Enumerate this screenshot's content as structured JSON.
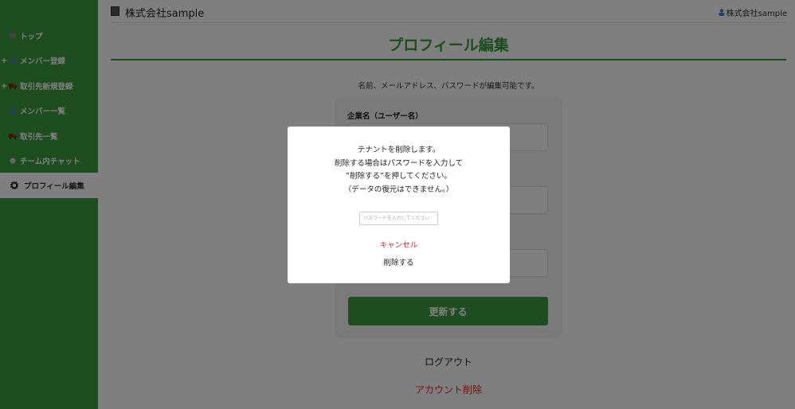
{
  "sidebar": {
    "items": [
      {
        "label": "トップ",
        "icon": "home-icon",
        "plus": ""
      },
      {
        "label": "メンバー登録",
        "icon": "user-icon",
        "plus": "+"
      },
      {
        "label": "取引先新規登録",
        "icon": "truck-icon",
        "plus": "+"
      },
      {
        "label": "メンバー一覧",
        "icon": "users-icon",
        "plus": ""
      },
      {
        "label": "取引先一覧",
        "icon": "truck-icon",
        "plus": ""
      },
      {
        "label": "チーム内チャット",
        "icon": "chat-icon",
        "plus": ""
      },
      {
        "label": "プロフィール編集",
        "icon": "gear-icon",
        "plus": "",
        "active": true
      }
    ]
  },
  "header": {
    "company": "株式会社sample",
    "user": "株式会社sample"
  },
  "main": {
    "title": "プロフィール編集",
    "subtitle": "名前、メールアドレス、パスワードが編集可能です。",
    "field_label": "企業名（ユーザー名）",
    "update_button": "更新する",
    "logout": "ログアウト",
    "delete_account": "アカウント削除"
  },
  "modal": {
    "line1": "テナントを削除します。",
    "line2": "削除する場合はパスワードを入力して",
    "line3": "”削除する”を押してください。",
    "line4": "（データの復元はできません。）",
    "password_placeholder": "パスワードを入力してください",
    "cancel": "キャンセル",
    "confirm": "削除する"
  },
  "colors": {
    "brand_green": "#3c9a3e",
    "danger_red": "#d9262a",
    "overlay": "rgba(0,0,0,0.5)"
  }
}
